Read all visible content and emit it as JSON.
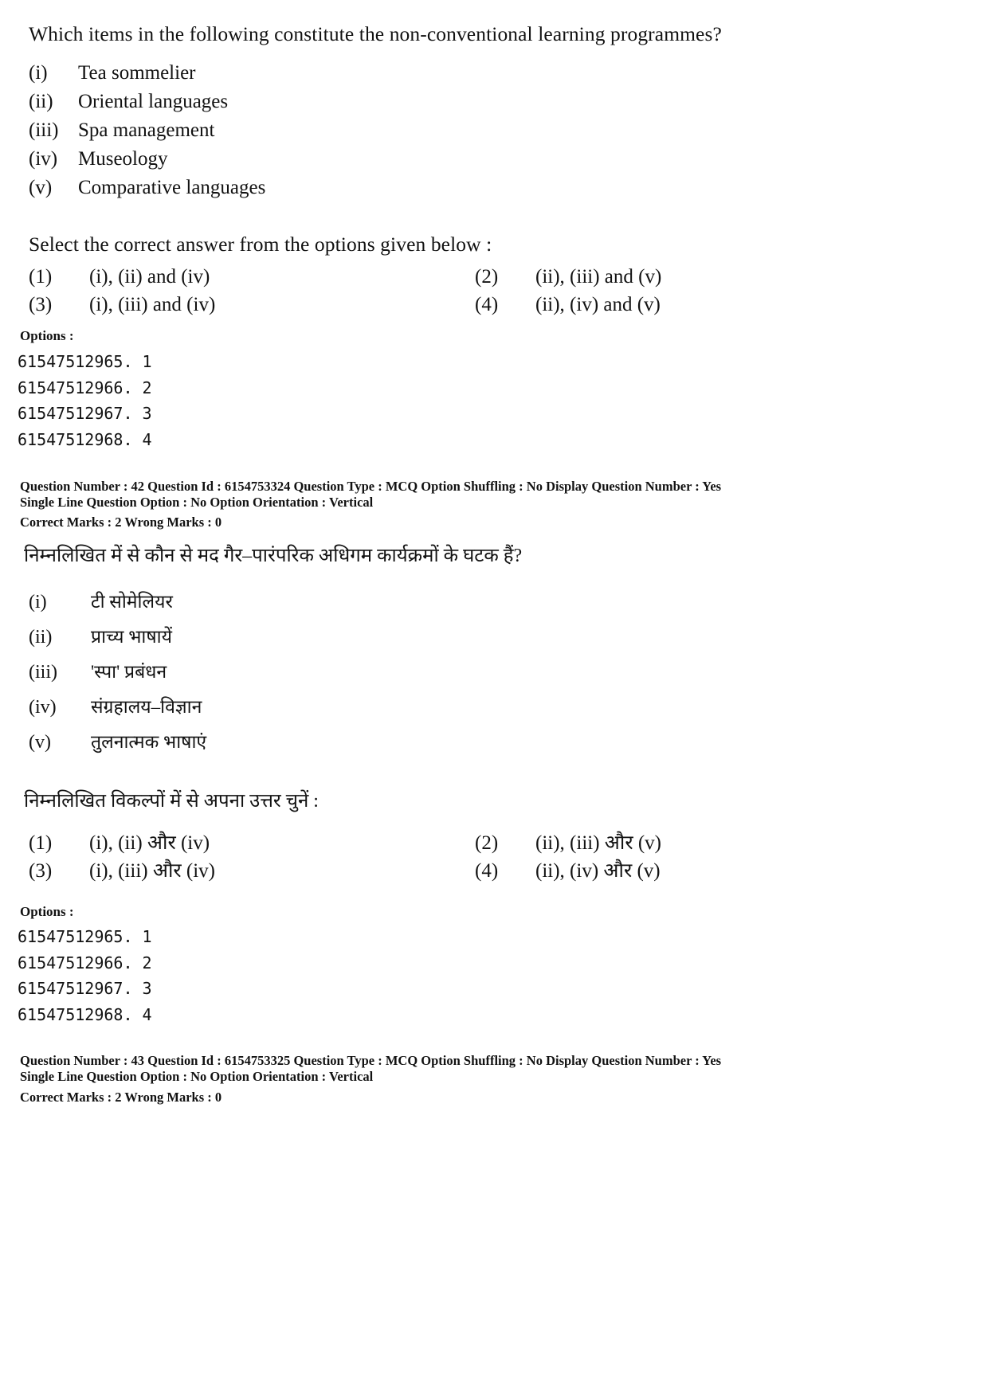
{
  "document": {
    "page_background": "#ffffff",
    "text_color": "#121212"
  },
  "question_42": {
    "stem": "Which items in the following constitute the non-conventional learning programmes?",
    "items": [
      {
        "num": "(i)",
        "text": "Tea sommelier"
      },
      {
        "num": "(ii)",
        "text": "Oriental languages"
      },
      {
        "num": "(iii)",
        "text": "Spa management"
      },
      {
        "num": "(iv)",
        "text": "Museology"
      },
      {
        "num": "(v)",
        "text": "Comparative languages"
      }
    ],
    "select_instruction": "Select the correct answer from the options given below :",
    "choices": [
      {
        "label": "(1)",
        "text": "(i), (ii) and (iv)"
      },
      {
        "label": "(2)",
        "text": "(ii), (iii) and (v)"
      },
      {
        "label": "(3)",
        "text": "(i), (iii) and (iv)"
      },
      {
        "label": "(4)",
        "text": "(ii), (iv) and (v)"
      }
    ],
    "options_heading": "Options :",
    "option_ids": [
      "61547512965. 1",
      "61547512966. 2",
      "61547512967. 3",
      "61547512968. 4"
    ],
    "meta": {
      "line1": "Question Number : 42  Question Id : 6154753324  Question Type : MCQ  Option Shuffling : No  Display Question Number : Yes",
      "line2": "Single Line Question Option : No  Option Orientation : Vertical",
      "marks": "Correct Marks : 2  Wrong Marks : 0"
    }
  },
  "question_43": {
    "stem": "निम्नलिखित में से कौन से मद गैर–पारंपरिक अधिगम कार्यक्रमों के घटक हैं?",
    "items": [
      {
        "num": "(i)",
        "text": "टी सोमेलियर"
      },
      {
        "num": "(ii)",
        "text": "प्राच्य भाषायें"
      },
      {
        "num": "(iii)",
        "text": "'स्पा' प्रबंधन"
      },
      {
        "num": "(iv)",
        "text": "संग्रहालय–विज्ञान"
      },
      {
        "num": "(v)",
        "text": "तुलनात्मक भाषाएं"
      }
    ],
    "select_instruction": "निम्नलिखित विकल्पों में से अपना उत्तर चुनें :",
    "choices": [
      {
        "label": "(1)",
        "text": "(i), (ii) और (iv)"
      },
      {
        "label": "(2)",
        "text": "(ii), (iii) और (v)"
      },
      {
        "label": "(3)",
        "text": "(i), (iii) और (iv)"
      },
      {
        "label": "(4)",
        "text": "(ii), (iv) और (v)"
      }
    ],
    "options_heading": "Options :",
    "option_ids": [
      "61547512965. 1",
      "61547512966. 2",
      "61547512967. 3",
      "61547512968. 4"
    ],
    "meta": {
      "line1": "Question Number : 43  Question Id : 6154753325  Question Type : MCQ  Option Shuffling : No  Display Question Number : Yes",
      "line2": "Single Line Question Option : No  Option Orientation : Vertical",
      "marks": "Correct Marks : 2  Wrong Marks : 0"
    }
  }
}
